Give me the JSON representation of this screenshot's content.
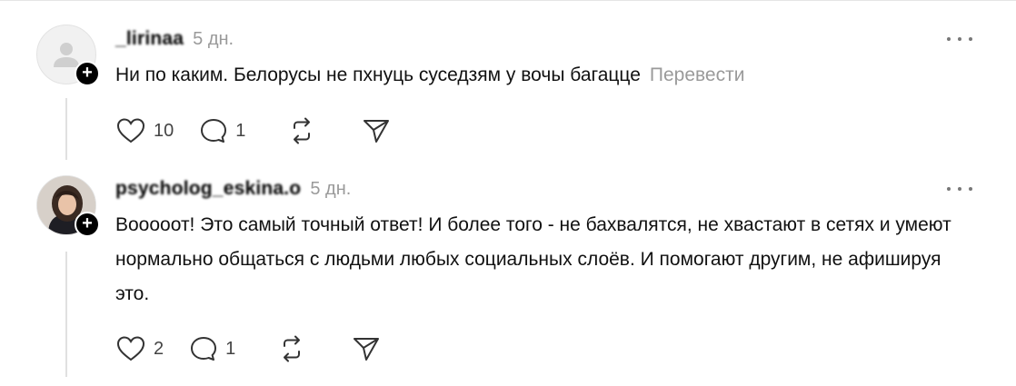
{
  "posts": [
    {
      "username": "_lirinaa",
      "time": "5 дн.",
      "text": "Ни по каким. Белорусы не пхнуць суседзям у вочы багацце",
      "translate_label": "Перевести",
      "likes": "10",
      "replies": "1",
      "avatar": "default-user-icon"
    },
    {
      "username": "psycholog_eskina.o",
      "time": "5 дн.",
      "text": "Вооооот! Это самый точный ответ! И более того - не бахвалятся, не хвастают в сетях и умеют нормально общаться с людьми любых социальных слоёв. И помогают другим, не афишируя это.",
      "likes": "2",
      "replies": "1",
      "avatar": "profile-photo"
    }
  ],
  "icons": {
    "like": "heart-icon",
    "reply": "comment-icon",
    "repost": "repost-icon",
    "share": "send-icon",
    "more": "more-icon",
    "follow": "plus-icon"
  },
  "colors": {
    "text": "#111111",
    "muted": "#9a9a9a",
    "badge": "#000000",
    "thread_line": "#e0e0e0"
  }
}
